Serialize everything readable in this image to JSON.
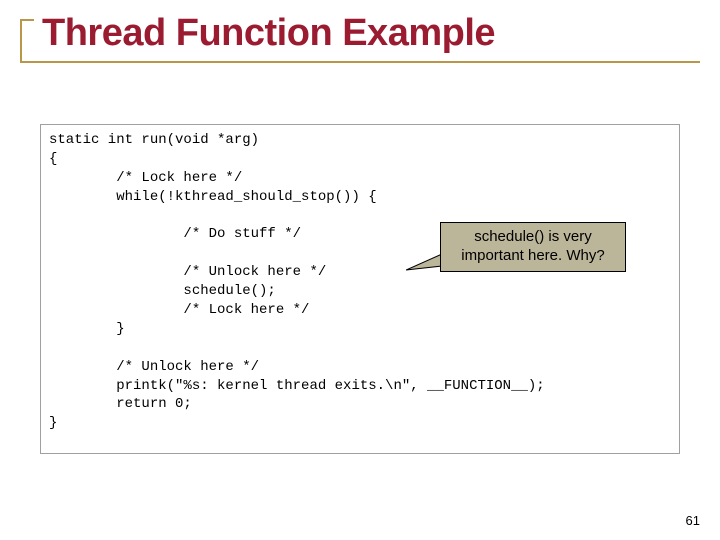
{
  "title": "Thread Function Example",
  "code": "static int run(void *arg)\n{\n        /* Lock here */\n        while(!kthread_should_stop()) {\n\n                /* Do stuff */\n\n                /* Unlock here */\n                schedule();\n                /* Lock here */\n        }\n\n        /* Unlock here */\n        printk(\"%s: kernel thread exits.\\n\", __FUNCTION__);\n        return 0;\n}",
  "callout": "schedule() is very important here.  Why?",
  "page_number": "61"
}
